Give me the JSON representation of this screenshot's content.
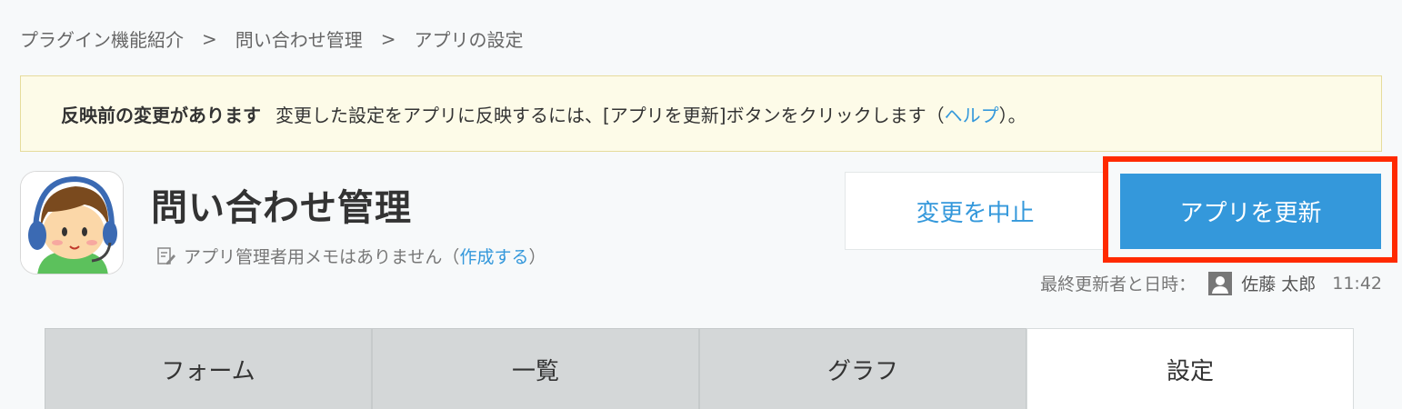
{
  "breadcrumb": {
    "items": [
      "プラグイン機能紹介",
      "問い合わせ管理",
      "アプリの設定"
    ],
    "separator": ">"
  },
  "notice": {
    "title": "反映前の変更があります",
    "message_before_link": "変更した設定をアプリに反映するには、[アプリを更新]ボタンをクリックします（",
    "help_link": "ヘルプ",
    "message_after_link": "）。"
  },
  "app": {
    "title": "問い合わせ管理",
    "memo_text": "アプリ管理者用メモはありません（",
    "memo_link": "作成する",
    "memo_close": "）"
  },
  "buttons": {
    "cancel_label": "変更を中止",
    "update_label": "アプリを更新"
  },
  "last_updated": {
    "label": "最終更新者と日時：",
    "user_name": "佐藤 太郎",
    "time": "11:42"
  },
  "tabs": [
    {
      "label": "フォーム"
    },
    {
      "label": "一覧"
    },
    {
      "label": "グラフ"
    },
    {
      "label": "設定"
    }
  ],
  "colors": {
    "accent": "#3498db",
    "highlight_frame": "#ff2a00",
    "notice_bg": "#fdfbe8"
  },
  "icons": {
    "app_icon": "headset-person-icon",
    "memo_icon": "edit-note-icon",
    "user_icon": "user-icon"
  }
}
